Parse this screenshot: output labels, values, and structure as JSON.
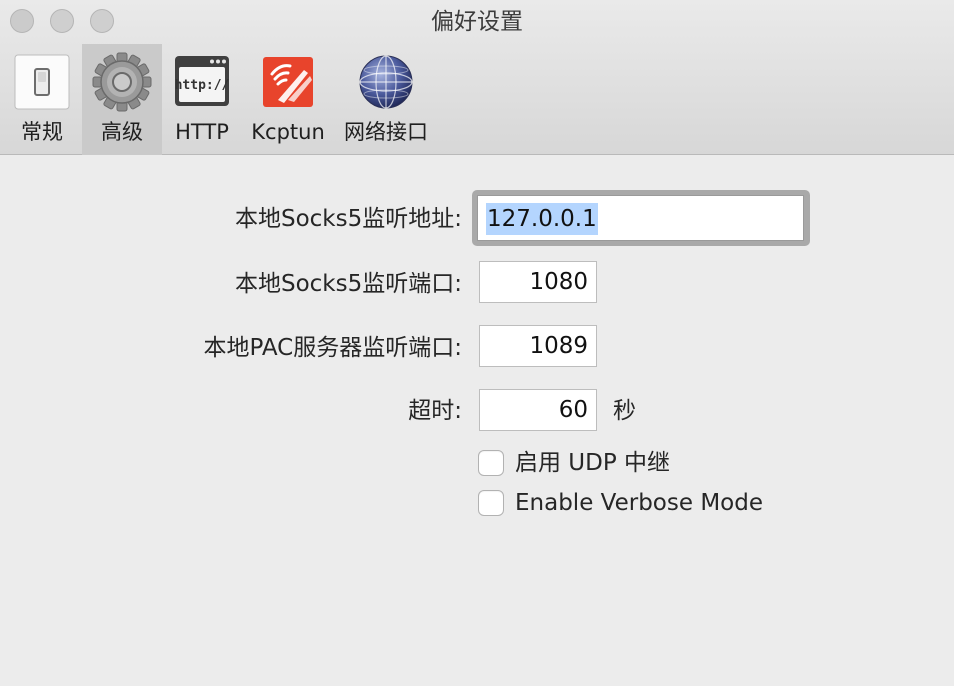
{
  "window": {
    "title": "偏好设置"
  },
  "toolbar": {
    "tabs": [
      {
        "label": "常规",
        "icon": "light-switch-icon"
      },
      {
        "label": "高级",
        "icon": "gear-icon",
        "selected": true
      },
      {
        "label": "HTTP",
        "icon": "http-browser-icon"
      },
      {
        "label": "Kcptun",
        "icon": "kcptun-signal-icon"
      },
      {
        "label": "网络接口",
        "icon": "network-globe-icon"
      }
    ]
  },
  "form": {
    "socks5_address": {
      "label": "本地Socks5监听地址:",
      "value": "127.0.0.1"
    },
    "socks5_port": {
      "label": "本地Socks5监听端口:",
      "value": "1080"
    },
    "pac_port": {
      "label": "本地PAC服务器监听端口:",
      "value": "1089"
    },
    "timeout": {
      "label": "超时:",
      "value": "60",
      "unit": "秒"
    },
    "udp_relay": {
      "label": "启用 UDP 中继",
      "checked": false
    },
    "verbose_mode": {
      "label": "Enable Verbose Mode",
      "checked": false
    }
  },
  "colors": {
    "selection_highlight": "#b4d5fe",
    "selected_tab": "#cacaca",
    "kcptun_brand": "#e8442c"
  }
}
